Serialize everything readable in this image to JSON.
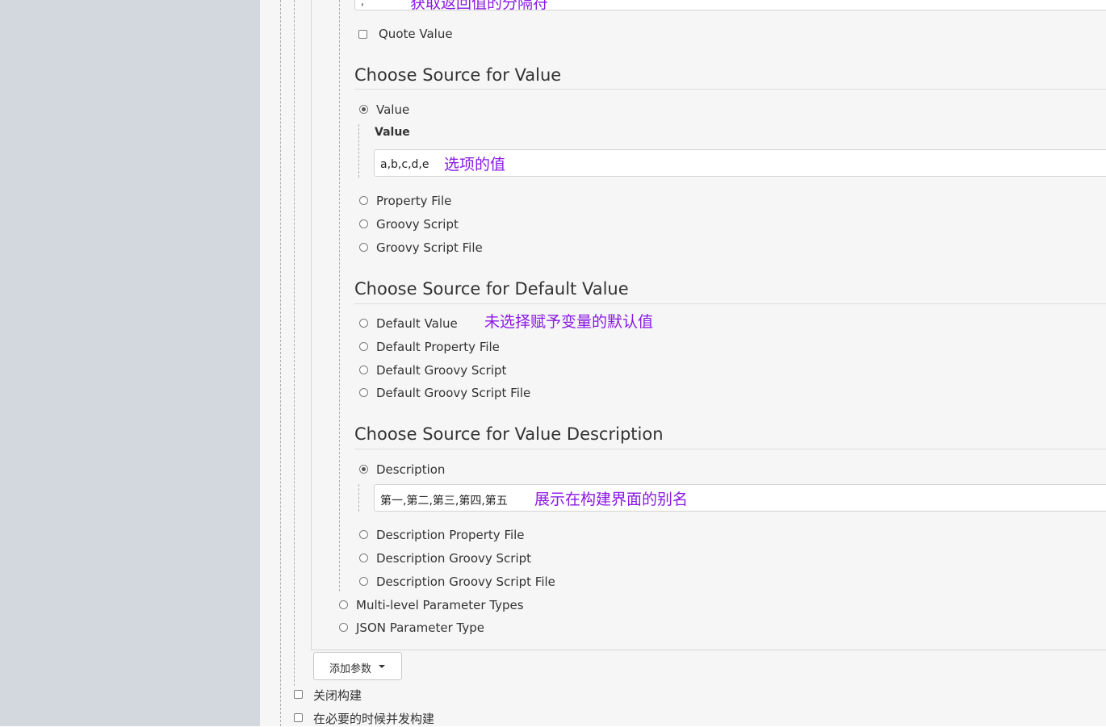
{
  "top_field": {
    "partial_value": ",",
    "annotation": "获取返回值的分隔符"
  },
  "quote_value": {
    "label": "Quote Value",
    "checked": false
  },
  "value_section": {
    "title": "Choose Source for Value",
    "options": [
      {
        "label": "Value",
        "selected": true
      },
      {
        "label": "Property File",
        "selected": false
      },
      {
        "label": "Groovy Script",
        "selected": false
      },
      {
        "label": "Groovy Script File",
        "selected": false
      }
    ],
    "value_field_label": "Value",
    "value_field_value": "a,b,c,d,e",
    "value_annotation": "选项的值"
  },
  "default_section": {
    "title": "Choose Source for Default Value",
    "options": [
      {
        "label": "Default Value",
        "selected": false
      },
      {
        "label": "Default Property File",
        "selected": false
      },
      {
        "label": "Default Groovy Script",
        "selected": false
      },
      {
        "label": "Default Groovy Script File",
        "selected": false
      }
    ],
    "annotation": "未选择赋予变量的默认值"
  },
  "description_section": {
    "title": "Choose Source for Value Description",
    "options": [
      {
        "label": "Description",
        "selected": true
      },
      {
        "label": "Description Property File",
        "selected": false
      },
      {
        "label": "Description Groovy Script",
        "selected": false
      },
      {
        "label": "Description Groovy Script File",
        "selected": false
      }
    ],
    "description_value": "第一,第二,第三,第四,第五",
    "annotation": "展示在构建界面的别名"
  },
  "parameter_types": [
    {
      "label": "Multi-level Parameter Types",
      "selected": false
    },
    {
      "label": "JSON Parameter Type",
      "selected": false
    }
  ],
  "add_param_button": {
    "label": "添加参数"
  },
  "build_options": [
    {
      "label": "关闭构建",
      "checked": false
    },
    {
      "label": "在必要的时候并发构建",
      "checked": false
    }
  ]
}
